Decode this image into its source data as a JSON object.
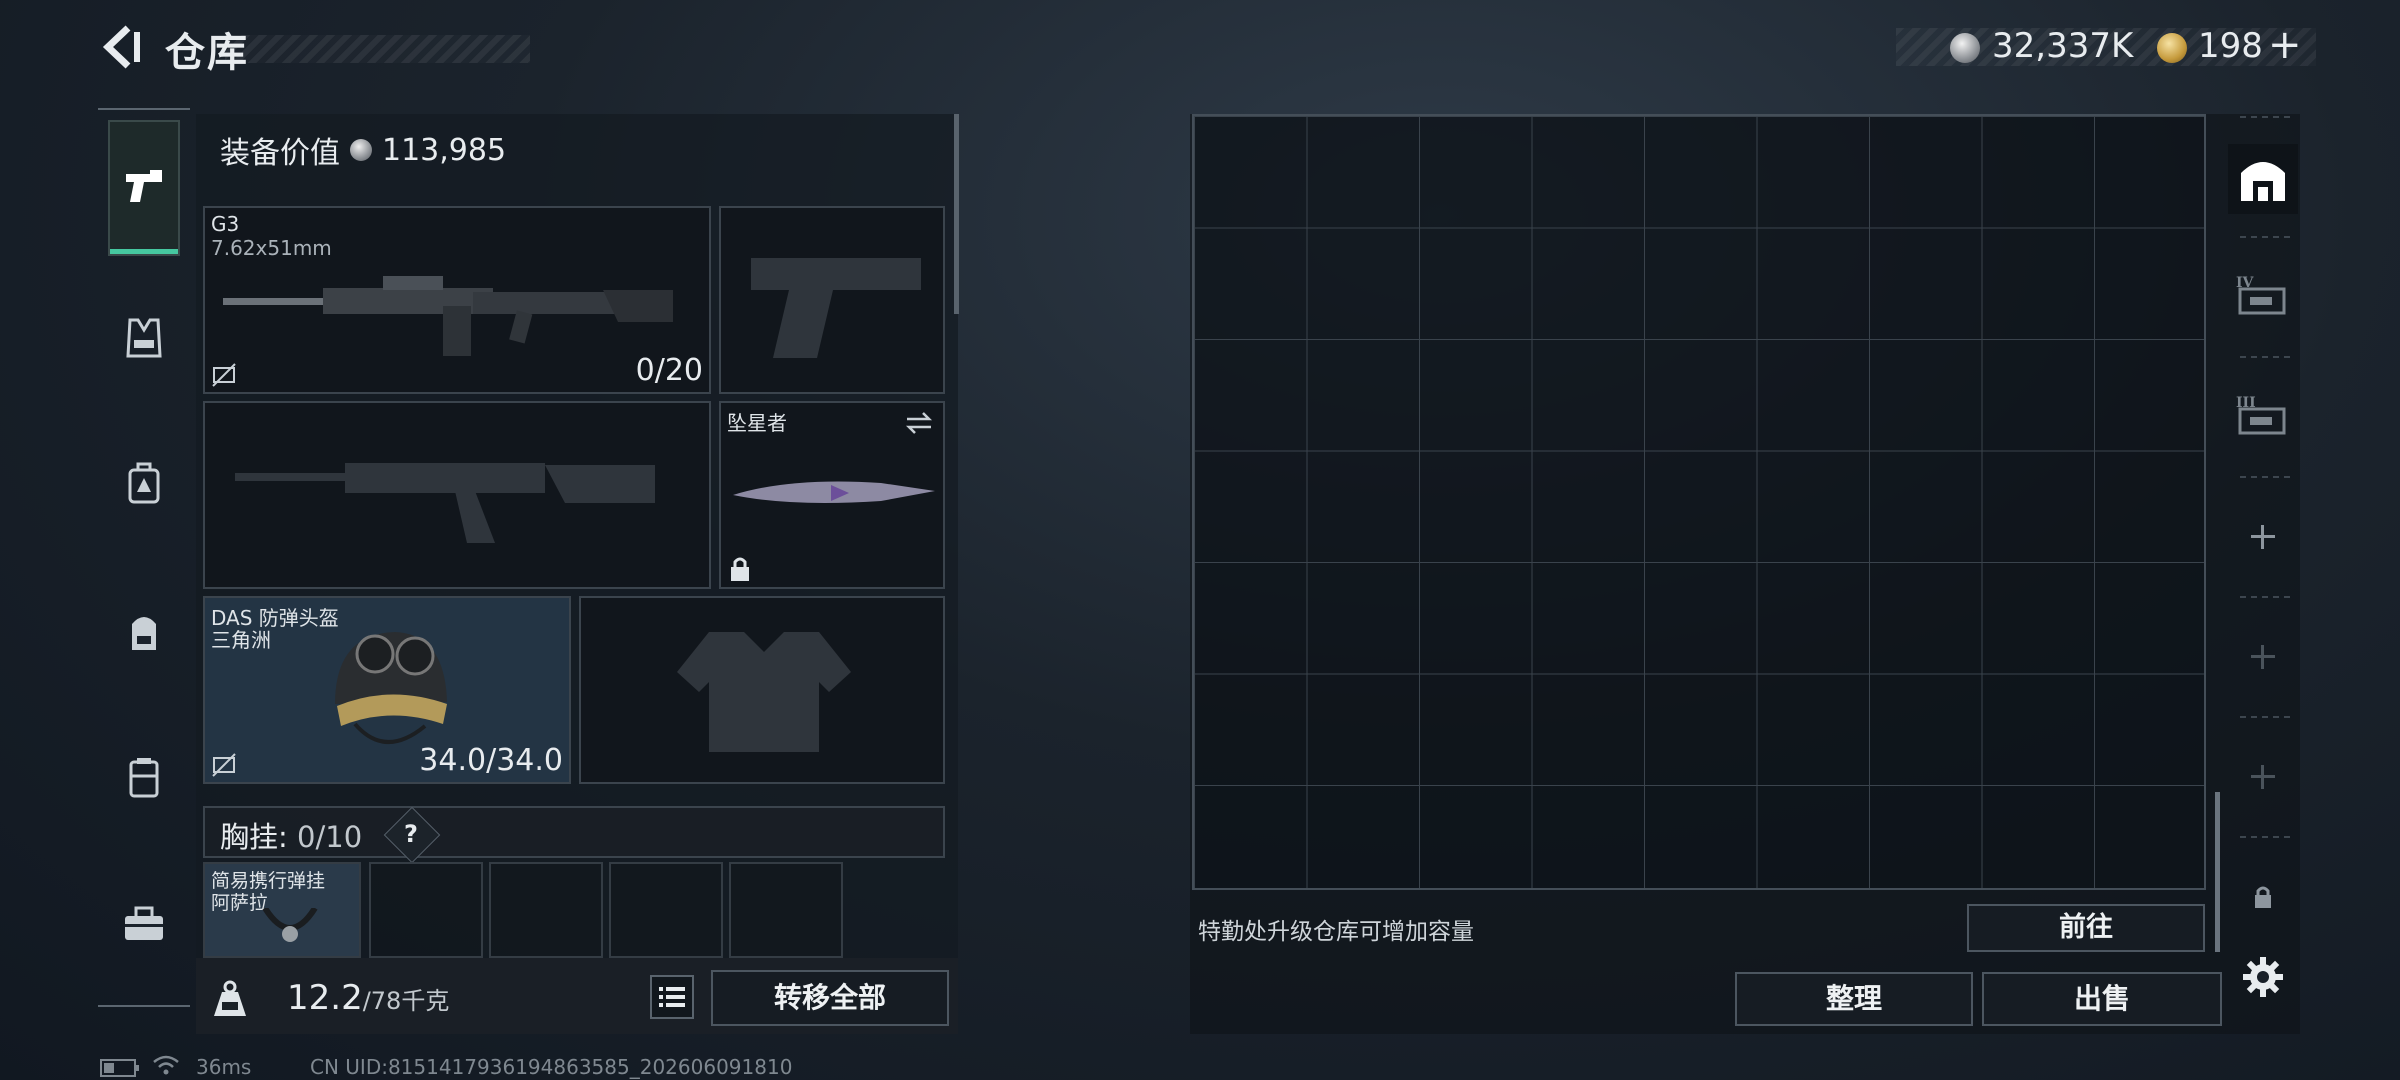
{
  "header": {
    "title": "仓库"
  },
  "currency": {
    "silver": "32,337K",
    "gold": "198",
    "add": "+"
  },
  "equipment": {
    "value_label": "装备价值",
    "value": "113,985",
    "primary": {
      "name": "G3",
      "caliber": "7.62x51mm",
      "ammo": "0/20"
    },
    "melee": {
      "name": "坠星者"
    },
    "helmet": {
      "name": "DAS 防弹头盔",
      "tag": "三角洲",
      "durability": "34.0/34.0"
    },
    "chest_rig": {
      "label": "胸挂",
      "sep": ":",
      "capacity": "0/10",
      "help": "?"
    },
    "rig_item": {
      "name": "简易携行弹挂",
      "tag": "阿萨拉"
    }
  },
  "footer": {
    "weight_current": "12.2",
    "weight_max": "/78千克",
    "transfer_all": "转移全部"
  },
  "storage": {
    "hint": "特勤处升级仓库可增加容量",
    "goto": "前往",
    "arrange": "整理",
    "sell": "出售"
  },
  "status": {
    "ping": "36ms",
    "uid": "CN UID:8151417936194863585_202606091810"
  },
  "colors": {
    "accent": "#46c8a0",
    "panel": "#141a21"
  }
}
